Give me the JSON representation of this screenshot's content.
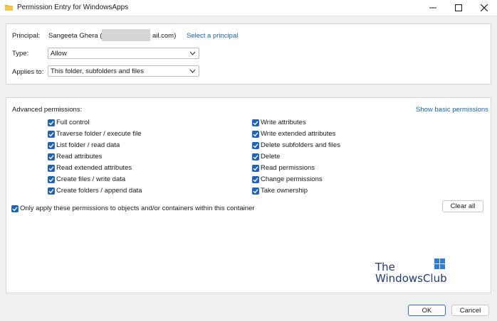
{
  "window": {
    "title": "Permission Entry for WindowsApps",
    "controls": {
      "minimize": "–",
      "maximize": "☐",
      "close": "✕"
    }
  },
  "header": {
    "principal_label": "Principal:",
    "principal_name": "Sangeeta Ghera (s",
    "principal_suffix": "ail.com)",
    "select_principal_link": "Select a principal",
    "type_label": "Type:",
    "type_value": "Allow",
    "applies_label": "Applies to:",
    "applies_value": "This folder, subfolders and files"
  },
  "advanced": {
    "heading": "Advanced permissions:",
    "show_basic_link": "Show basic permissions",
    "left_permissions": [
      {
        "label": "Full control",
        "checked": true
      },
      {
        "label": "Traverse folder / execute file",
        "checked": true
      },
      {
        "label": "List folder / read data",
        "checked": true
      },
      {
        "label": "Read attributes",
        "checked": true
      },
      {
        "label": "Read extended attributes",
        "checked": true
      },
      {
        "label": "Create files / write data",
        "checked": true
      },
      {
        "label": "Create folders / append data",
        "checked": true
      }
    ],
    "right_permissions": [
      {
        "label": "Write attributes",
        "checked": true
      },
      {
        "label": "Write extended attributes",
        "checked": true
      },
      {
        "label": "Delete subfolders and files",
        "checked": true
      },
      {
        "label": "Delete",
        "checked": true
      },
      {
        "label": "Read permissions",
        "checked": true
      },
      {
        "label": "Change permissions",
        "checked": true
      },
      {
        "label": "Take ownership",
        "checked": true
      }
    ],
    "only_apply_label": "Only apply these permissions to objects and/or containers within this container",
    "clear_all_label": "Clear all"
  },
  "watermark": {
    "line1": "The",
    "line2": "WindowsClub"
  },
  "footer": {
    "ok_label": "OK",
    "cancel_label": "Cancel"
  },
  "colors": {
    "accent": "#1f63b5",
    "link": "#1a63b8"
  }
}
